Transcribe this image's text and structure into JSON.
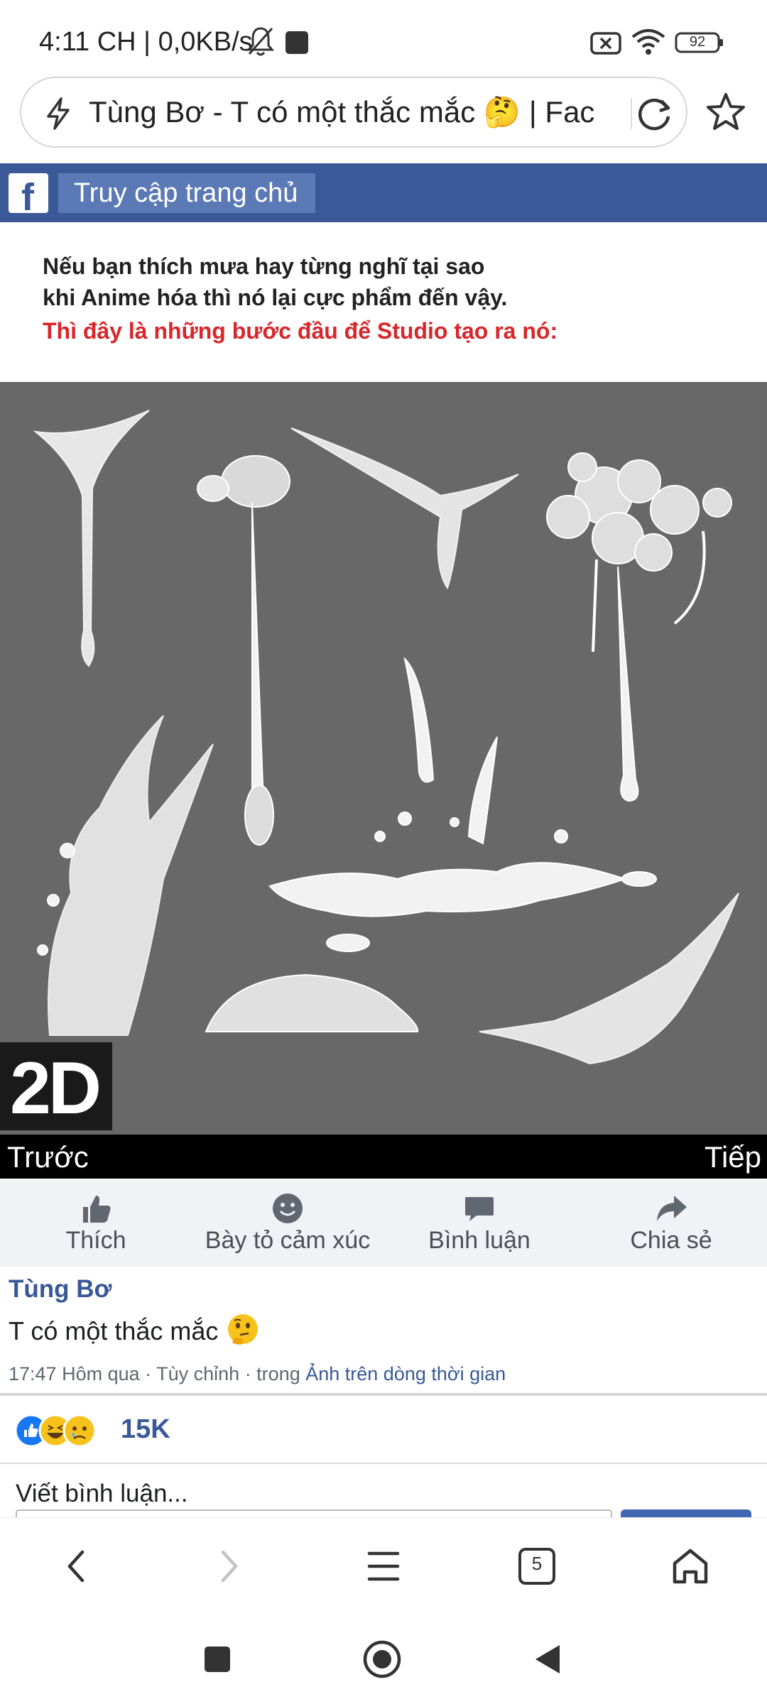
{
  "status_bar": {
    "time": "4:11 CH | 0,0KB/s",
    "battery": "92"
  },
  "browser": {
    "url_text": "Tùng Bơ - T có một thắc mắc 🤔 | Fac",
    "tab_count": "5"
  },
  "facebook": {
    "logo_letter": "f",
    "home_link": "Truy cập trang chủ"
  },
  "image": {
    "caption_line1": "Nếu bạn thích mưa hay từng nghĩ tại sao",
    "caption_line2": "khi Anime hóa thì nó lại cực phẩm đến vậy.",
    "caption_line3": "Thì đây là những bước đầu để Studio tạo ra nó:",
    "badge": "2D",
    "prev_label": "Trước",
    "next_label": "Tiếp"
  },
  "actions": {
    "like": "Thích",
    "react": "Bày tỏ cảm xúc",
    "comment": "Bình luận",
    "share": "Chia sẻ"
  },
  "post": {
    "author": "Tùng Bơ",
    "text": "T có một thắc mắc",
    "meta_prefix": "17:47 Hôm qua · Tùy chỉnh · trong ",
    "meta_link": "Ảnh trên dòng thời gian"
  },
  "reactions": {
    "count": "15K",
    "types": [
      "like-icon",
      "haha-icon",
      "sad-icon"
    ]
  },
  "comment_box": {
    "label": "Viết bình luận..."
  },
  "colors": {
    "facebook_blue": "#3b5998",
    "link_blue": "#385898",
    "caption_red": "#d8262a",
    "art_background": "#686868"
  }
}
